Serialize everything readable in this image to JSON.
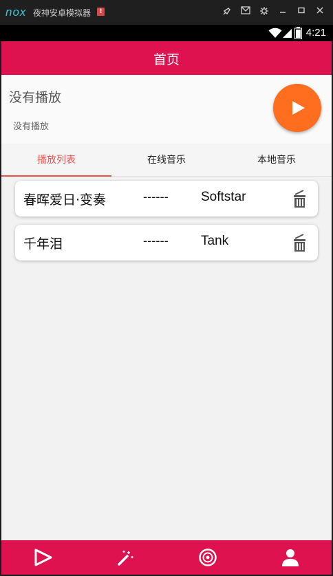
{
  "window": {
    "logo": "nox",
    "app_name": "夜神安卓模拟器",
    "warn_badge": "!",
    "controls": [
      "pin-icon",
      "mail-icon",
      "settings-icon",
      "minimize-icon",
      "maximize-icon",
      "close-icon"
    ]
  },
  "status_bar": {
    "time": "4:21"
  },
  "app_bar": {
    "title": "首页"
  },
  "now_playing": {
    "title": "没有播放",
    "subtitle": "没有播放",
    "play_icon": "play-icon",
    "accent": "#ff6d1f"
  },
  "tabs": [
    {
      "label": "播放列表",
      "active": true
    },
    {
      "label": "在线音乐",
      "active": false
    },
    {
      "label": "本地音乐",
      "active": false
    }
  ],
  "songs": [
    {
      "title": "春晖爱日·变奏",
      "separator": "------",
      "artist": "Softstar"
    },
    {
      "title": "千年泪",
      "separator": "------",
      "artist": "Tank"
    }
  ],
  "bottom_nav": [
    {
      "icon": "play-nav-icon"
    },
    {
      "icon": "magic-wand-icon"
    },
    {
      "icon": "radio-disc-icon"
    },
    {
      "icon": "profile-icon"
    }
  ],
  "colors": {
    "primary": "#dd124f",
    "tab_active": "#e6524f"
  }
}
